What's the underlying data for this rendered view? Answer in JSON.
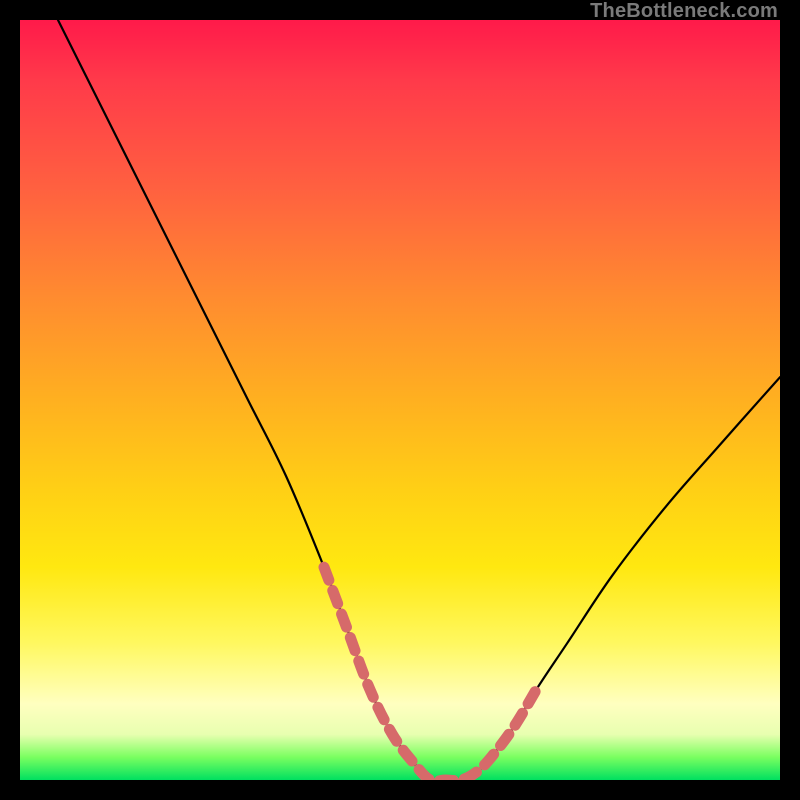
{
  "watermark": "TheBottleneck.com",
  "colors": {
    "background": "#000000",
    "curve": "#000000",
    "marker": "#d66a6a",
    "gradient_top": "#ff1a4a",
    "gradient_bottom": "#00e060"
  },
  "chart_data": {
    "type": "line",
    "title": "",
    "xlabel": "",
    "ylabel": "",
    "xlim": [
      0,
      100
    ],
    "ylim": [
      0,
      100
    ],
    "grid": false,
    "legend": false,
    "series": [
      {
        "name": "bottleneck-curve",
        "x": [
          5,
          10,
          15,
          20,
          25,
          30,
          35,
          40,
          43,
          46,
          49,
          52,
          54,
          56,
          58,
          60,
          62,
          65,
          68,
          72,
          78,
          85,
          92,
          100
        ],
        "y": [
          100,
          90,
          80,
          70,
          60,
          50,
          40,
          28,
          20,
          12,
          6,
          2,
          0,
          0,
          0,
          1,
          3,
          7,
          12,
          18,
          27,
          36,
          44,
          53
        ]
      }
    ],
    "annotations": [
      {
        "name": "highlighted-segment",
        "note": "pink/coral thick dashed overlay on the valley portion of the curve",
        "x": [
          40,
          43,
          46,
          49,
          52,
          54,
          56,
          58,
          60,
          62,
          65,
          68
        ],
        "y": [
          28,
          20,
          12,
          6,
          2,
          0,
          0,
          0,
          1,
          3,
          7,
          12
        ]
      }
    ]
  }
}
